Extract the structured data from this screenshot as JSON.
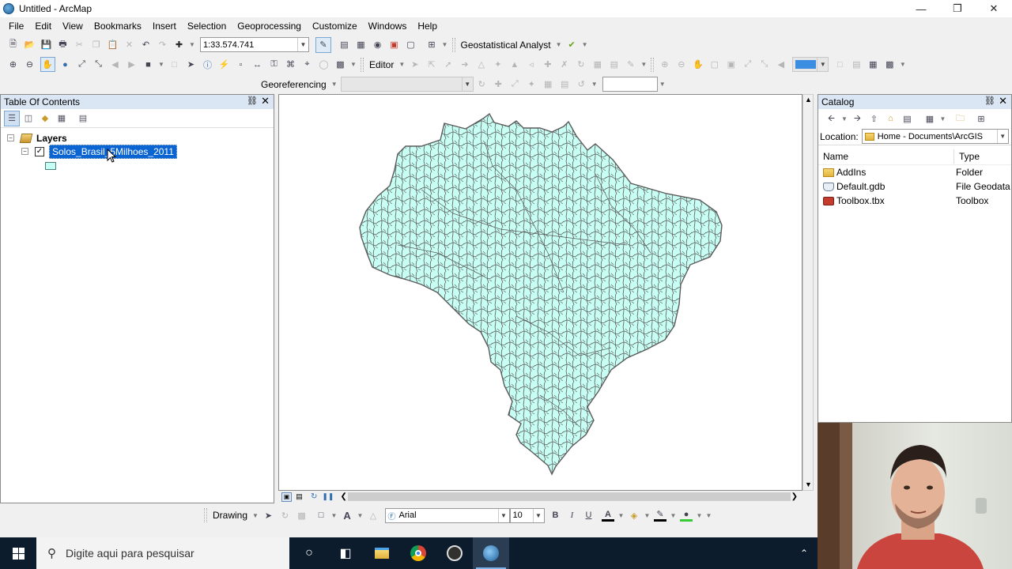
{
  "window": {
    "title": "Untitled - ArcMap"
  },
  "menu": [
    "File",
    "Edit",
    "View",
    "Bookmarks",
    "Insert",
    "Selection",
    "Geoprocessing",
    "Customize",
    "Windows",
    "Help"
  ],
  "toolbar": {
    "scale": "1:33.574.741",
    "geostat_label": "Geostatistical Analyst",
    "editor_label": "Editor",
    "georef_label": "Georeferencing"
  },
  "toc": {
    "title": "Table Of Contents",
    "root": "Layers",
    "layer_name": "Solos_Brasil_5Milhoes_2011",
    "layer_checked": true
  },
  "catalog": {
    "title": "Catalog",
    "location_label": "Location:",
    "location_value": "Home - Documents\\ArcGIS",
    "col_name": "Name",
    "col_type": "Type",
    "items": [
      {
        "name": "AddIns",
        "type": "Folder",
        "icon": "folder"
      },
      {
        "name": "Default.gdb",
        "type": "File Geodata",
        "icon": "gdb"
      },
      {
        "name": "Toolbox.tbx",
        "type": "Toolbox",
        "icon": "tbx"
      }
    ]
  },
  "drawing": {
    "label": "Drawing",
    "font": "Arial",
    "size": "10"
  },
  "taskbar": {
    "search_placeholder": "Digite aqui para pesquisar"
  },
  "colors": {
    "map_fill": "#c8fff4",
    "map_stroke": "#5a5a5a",
    "selection": "#0a64d2",
    "pane_header": "#dbe6f4"
  }
}
